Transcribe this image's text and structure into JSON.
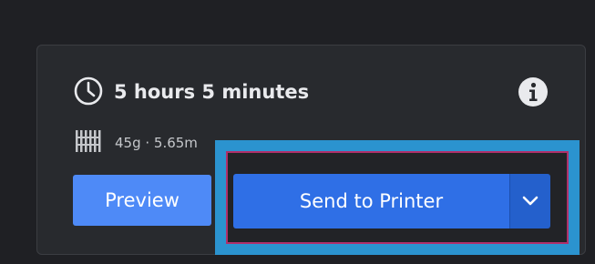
{
  "print_summary": {
    "time": "5 hours 5 minutes",
    "material": "45g · 5.65m"
  },
  "actions": {
    "preview_label": "Preview",
    "send_label": "Send to Printer"
  },
  "icons": {
    "time": "clock-icon",
    "info": "info-icon",
    "material": "filament-icon",
    "dropdown": "chevron-down-icon"
  },
  "colors": {
    "background": "#1f2024",
    "panel": "#282a2e",
    "preview_button": "#4e8af7",
    "send_button": "#2f6fe6",
    "highlight": "#2b93cf"
  }
}
